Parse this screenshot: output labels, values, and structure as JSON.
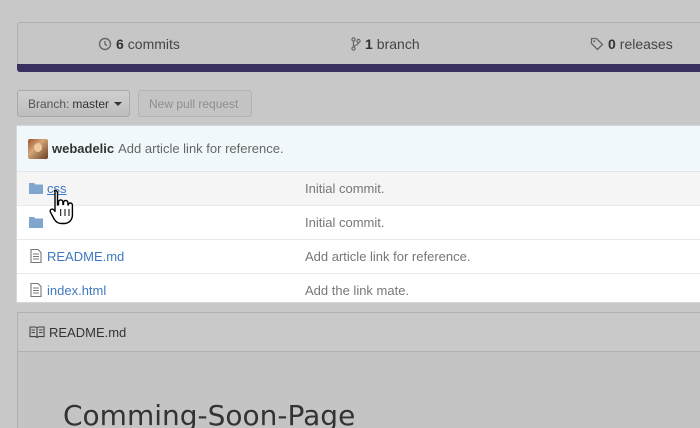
{
  "summary": {
    "commits": {
      "count": "6",
      "label": "commits",
      "icon": "history-icon"
    },
    "branches": {
      "count": "1",
      "label": "branch",
      "icon": "branch-icon"
    },
    "releases": {
      "count": "0",
      "label": "releases",
      "icon": "tag-icon"
    }
  },
  "language_bar_color": "#3b2f5f",
  "toolbar": {
    "branch_prefix": "Branch:",
    "branch_value": "master",
    "new_pr_label": "New pull request"
  },
  "latest_commit": {
    "author": "webadelic",
    "message": "Add article link for reference."
  },
  "files": [
    {
      "name": "css",
      "type": "folder",
      "message": "Initial commit."
    },
    {
      "name": "",
      "type": "folder",
      "message": "Initial commit."
    },
    {
      "name": "README.md",
      "type": "file",
      "message": "Add article link for reference."
    },
    {
      "name": "index.html",
      "type": "file",
      "message": "Add the link mate."
    }
  ],
  "readme": {
    "header": "README.md",
    "heading": "Comming-Soon-Page"
  },
  "colors": {
    "link": "#4078c0",
    "folder": "#80a6cd"
  }
}
